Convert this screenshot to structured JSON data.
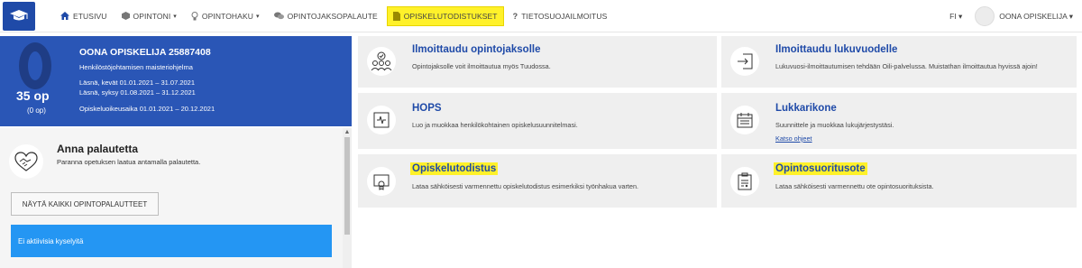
{
  "nav": {
    "items": [
      {
        "label": "ETUSIVU",
        "icon": "home-icon"
      },
      {
        "label": "OPINTONI",
        "icon": "cube-icon",
        "caret": "▾"
      },
      {
        "label": "OPINTOHAKU",
        "icon": "bulb-icon",
        "caret": "▾"
      },
      {
        "label": "OPINTOJAKSOPALAUTE",
        "icon": "chat-icon"
      },
      {
        "label": "OPISKELUTODISTUKSET",
        "icon": "document-icon"
      },
      {
        "label": "TIETOSUOJAILMOITUS",
        "icon": "question-icon"
      }
    ],
    "lang": "FI ▾",
    "user": "OONA OPISKELIJA ▾"
  },
  "profile": {
    "name": "OONA OPISKELIJA 25887408",
    "program": "Henkilöstöjohtamisen maisteriohjelma",
    "term1": "Läsnä, kevät 01.01.2021 – 31.07.2021",
    "term2": "Läsnä, syksy 01.08.2021 – 31.12.2021",
    "right": "Opiskeluoikeusaika 01.01.2021 – 20.12.2021",
    "credits": "35 op",
    "credits_sub": "(0 op)"
  },
  "feedback": {
    "title": "Anna palautetta",
    "subtitle": "Paranna opetuksen laatua antamalla palautetta.",
    "button": "NÄYTÄ KAIKKI OPINTOPALAUTTEET",
    "alert": "Ei aktiivisia kyselyitä"
  },
  "cards": {
    "enroll": {
      "title": "Ilmoittaudu opintojaksolle",
      "desc": "Opintojaksolle voit ilmoittautua myös Tuudossa."
    },
    "year": {
      "title": "Ilmoittaudu lukuvuodelle",
      "desc": "Lukuvuosi-ilmoittautumisen tehdään Oili-palvelussa. Muistathan ilmoittautua hyvissä ajoin!"
    },
    "hops": {
      "title": "HOPS",
      "desc": "Luo ja muokkaa henkilökohtainen opiskelusuunnitelmasi."
    },
    "calendar": {
      "title": "Lukkarikone",
      "desc": "Suunnittele ja muokkaa lukujärjestystäsi.",
      "link": "Katso ohjeet"
    },
    "certificate": {
      "title": "Opiskelutodistus",
      "desc": "Lataa sähköisesti varmennettu opiskelutodistus esimerkiksi työnhakua varten."
    },
    "transcript": {
      "title": "Opintosuoritusote",
      "desc": "Lataa sähköisesti varmennettu ote opintosuorituksista."
    }
  },
  "colors": {
    "brand": "#2a56b6",
    "highlight": "#fff12a",
    "alert": "#2496f3",
    "link": "#1f4aa8"
  }
}
